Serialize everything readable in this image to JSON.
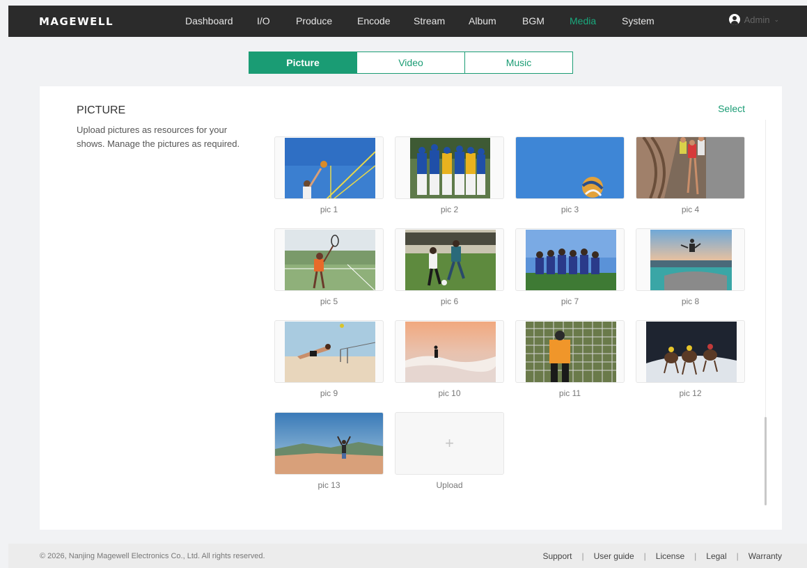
{
  "app": {
    "logo": "MAGEWELL"
  },
  "nav": {
    "items": [
      {
        "label": "Dashboard",
        "active": false
      },
      {
        "label": "I/O",
        "active": false
      },
      {
        "label": "Produce",
        "active": false
      },
      {
        "label": "Encode",
        "active": false
      },
      {
        "label": "Stream",
        "active": false
      },
      {
        "label": "Album",
        "active": false
      },
      {
        "label": "BGM",
        "active": false
      },
      {
        "label": "Media",
        "active": true
      },
      {
        "label": "System",
        "active": false
      }
    ],
    "user": {
      "label": "Admin",
      "icon": "user-icon",
      "dropdown_icon": "chevron-down-icon"
    }
  },
  "tabs": [
    {
      "label": "Picture",
      "active": true
    },
    {
      "label": "Video",
      "active": false
    },
    {
      "label": "Music",
      "active": false
    }
  ],
  "section": {
    "title": "PICTURE",
    "description": "Upload pictures as resources for your shows. Manage the pictures as required.",
    "select_label": "Select"
  },
  "pictures": [
    {
      "name": "pic 1"
    },
    {
      "name": "pic 2"
    },
    {
      "name": "pic 3"
    },
    {
      "name": "pic 4"
    },
    {
      "name": "pic 5"
    },
    {
      "name": "pic 6"
    },
    {
      "name": "pic 7"
    },
    {
      "name": "pic 8"
    },
    {
      "name": "pic 9"
    },
    {
      "name": "pic 10"
    },
    {
      "name": "pic 11"
    },
    {
      "name": "pic 12"
    },
    {
      "name": "pic 13"
    }
  ],
  "upload": {
    "label": "Upload",
    "icon": "plus-icon",
    "glyph": "+"
  },
  "footer": {
    "copyright": "© 2026, Nanjing Magewell Electronics Co., Ltd. All rights reserved.",
    "links": [
      "Support",
      "User guide",
      "License",
      "Legal",
      "Warranty"
    ],
    "separator": "|"
  },
  "colors": {
    "accent": "#1a9c74",
    "nav_bg": "#2b2b2b"
  }
}
